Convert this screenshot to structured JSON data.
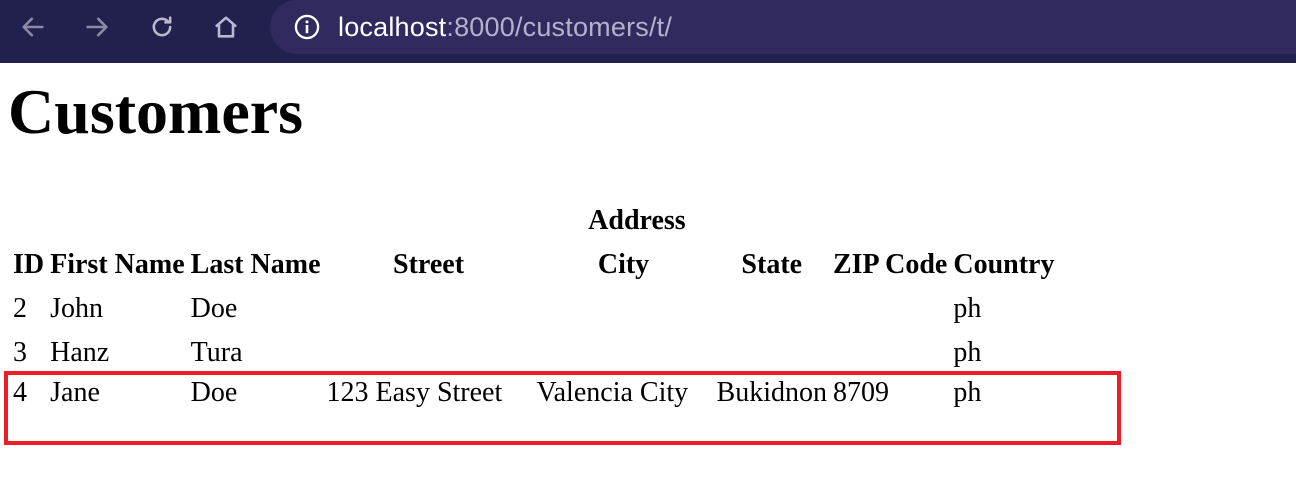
{
  "browser": {
    "url_host": "localhost",
    "url_rest": ":8000/customers/t/",
    "icons": [
      "back-arrow-icon",
      "forward-arrow-icon",
      "reload-icon",
      "home-icon",
      "info-icon"
    ]
  },
  "page": {
    "title": "Customers"
  },
  "table": {
    "group_header": "Address",
    "columns": [
      "ID",
      "First Name",
      "Last Name",
      "Street",
      "City",
      "State",
      "ZIP Code",
      "Country"
    ],
    "rows": [
      {
        "id": "2",
        "first_name": "John",
        "last_name": "Doe",
        "street": "",
        "city": "",
        "state": "",
        "zip": "",
        "country": "ph"
      },
      {
        "id": "3",
        "first_name": "Hanz",
        "last_name": "Tura",
        "street": "",
        "city": "",
        "state": "",
        "zip": "",
        "country": "ph"
      },
      {
        "id": "4",
        "first_name": "Jane",
        "last_name": "Doe",
        "street": "123 Easy Street",
        "city": "Valencia City",
        "state": "Bukidnon",
        "zip": "8709",
        "country": "ph"
      }
    ]
  },
  "colors": {
    "browser_bar": "#22204d",
    "url_box": "#302a5e",
    "highlight": "#ee1c25"
  }
}
